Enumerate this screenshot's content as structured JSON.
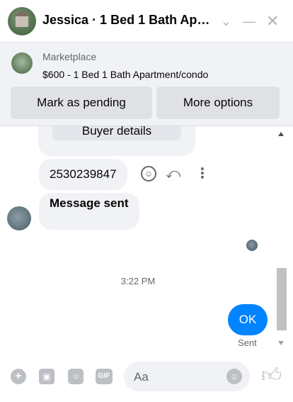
{
  "header": {
    "title": "Jessica · 1 Bed 1 Bath Apart…"
  },
  "marketplace": {
    "label": "Marketplace",
    "listing": "$600 - 1 Bed 1 Bath Apartment/condo",
    "buttons": {
      "pending": "Mark as pending",
      "more": "More options"
    }
  },
  "messages": {
    "buyer_details_label": "Buyer details",
    "phone": "2530239847",
    "message_sent": "Message sent",
    "timestamp": "3:22 PM",
    "ok": "OK",
    "sent_status": "Sent"
  },
  "composer": {
    "placeholder": "Aa",
    "gif_label": "GIF"
  },
  "colors": {
    "accent": "#0084ff",
    "bubble_bg": "#f0f2f5",
    "button_bg": "#dfe1e5"
  },
  "icons": [
    "chevron-down-icon",
    "minimize-icon",
    "close-icon",
    "emoji-icon",
    "reply-icon",
    "more-icon",
    "plus-icon",
    "photo-icon",
    "sticker-icon",
    "gif-icon",
    "like-icon"
  ]
}
